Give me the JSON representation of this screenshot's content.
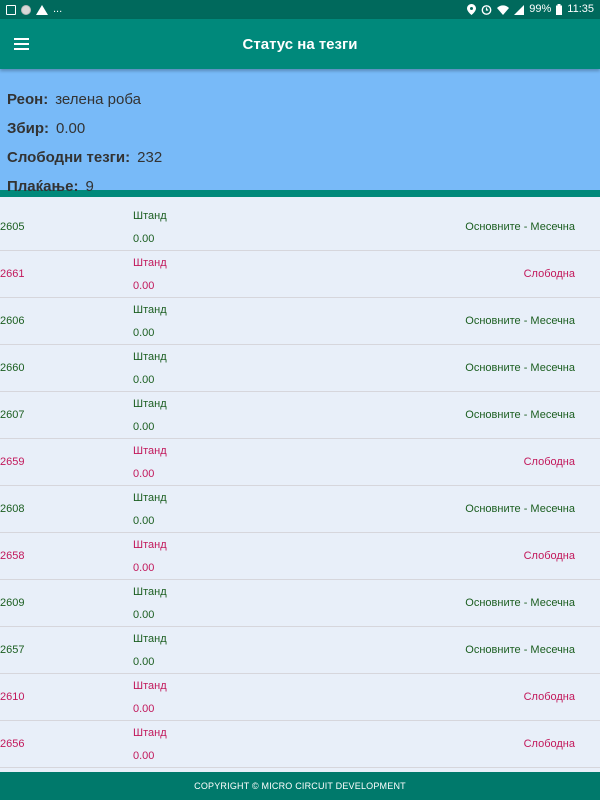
{
  "status_bar": {
    "left_icons": [
      "image-icon",
      "circle-app-icon",
      "warning-icon"
    ],
    "left_more": "...",
    "right_icons": [
      "location-icon",
      "alarm-icon",
      "wifi-icon",
      "signal-icon"
    ],
    "battery": "99%",
    "time": "11:35"
  },
  "app_bar": {
    "title": "Статус на тезги",
    "menu_icon": "hamburger-menu-icon"
  },
  "summary": {
    "region_label": "Реон:",
    "region_value": "зелена роба",
    "total_label": "Збир:",
    "total_value": "0.00",
    "free_label": "Слободни тезги:",
    "free_value": "232",
    "payment_label": "Плаќање:",
    "payment_value": "9"
  },
  "colors": {
    "green_text": "#1b5e20",
    "red_text": "#c2185b",
    "appbar": "#00897b",
    "summary_bg": "#78baf8"
  },
  "rows": [
    {
      "id": "2605",
      "stand": "Штанд",
      "amount": "0.00",
      "status": "Основните - Месечна",
      "color": "green"
    },
    {
      "id": "2661",
      "stand": "Штанд",
      "amount": "0.00",
      "status": "Слободна",
      "color": "red"
    },
    {
      "id": "2606",
      "stand": "Штанд",
      "amount": "0.00",
      "status": "Основните - Месечна",
      "color": "green"
    },
    {
      "id": "2660",
      "stand": "Штанд",
      "amount": "0.00",
      "status": "Основните - Месечна",
      "color": "green"
    },
    {
      "id": "2607",
      "stand": "Штанд",
      "amount": "0.00",
      "status": "Основните - Месечна",
      "color": "green"
    },
    {
      "id": "2659",
      "stand": "Штанд",
      "amount": "0.00",
      "status": "Слободна",
      "color": "red"
    },
    {
      "id": "2608",
      "stand": "Штанд",
      "amount": "0.00",
      "status": "Основните - Месечна",
      "color": "green"
    },
    {
      "id": "2658",
      "stand": "Штанд",
      "amount": "0.00",
      "status": "Слободна",
      "color": "red"
    },
    {
      "id": "2609",
      "stand": "Штанд",
      "amount": "0.00",
      "status": "Основните - Месечна",
      "color": "green"
    },
    {
      "id": "2657",
      "stand": "Штанд",
      "amount": "0.00",
      "status": "Основните - Месечна",
      "color": "green"
    },
    {
      "id": "2610",
      "stand": "Штанд",
      "amount": "0.00",
      "status": "Слободна",
      "color": "red"
    },
    {
      "id": "2656",
      "stand": "Штанд",
      "amount": "0.00",
      "status": "Слободна",
      "color": "red"
    }
  ],
  "footer": {
    "text": "COPYRIGHT © MICRO CIRCUIT DEVELOPMENT"
  }
}
